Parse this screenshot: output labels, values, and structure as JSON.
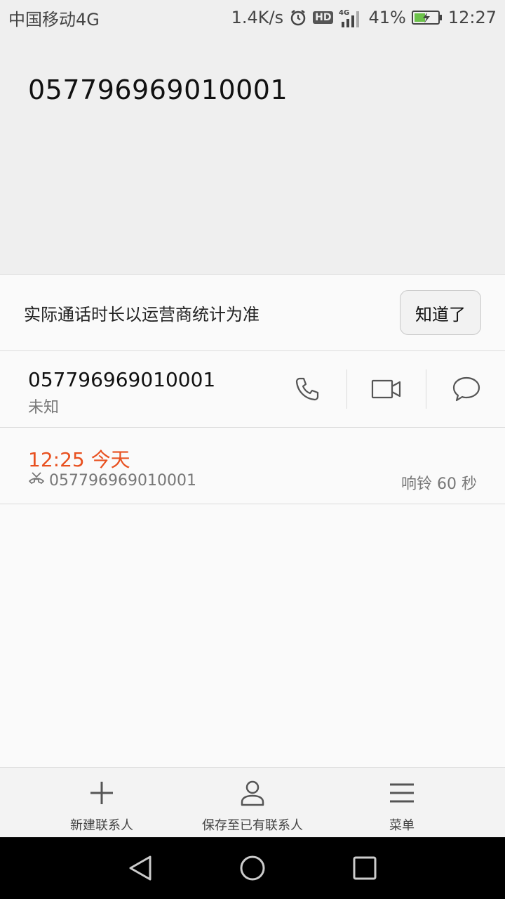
{
  "status_bar": {
    "carrier": "中国移动4G",
    "speed": "1.4K/s",
    "hd": "HD",
    "network": "4G",
    "battery": "41%",
    "time": "12:27"
  },
  "header": {
    "phone_number": "057796969010001"
  },
  "notice": {
    "text": "实际通话时长以运营商统计为准",
    "button_label": "知道了"
  },
  "contact": {
    "number": "057796969010001",
    "location": "未知",
    "actions": [
      "phone-icon",
      "video-call-icon",
      "message-icon"
    ]
  },
  "call_record": {
    "time": "12:25 今天",
    "number": "057796969010001",
    "duration": "响铃 60 秒",
    "accent_color": "#e8501f"
  },
  "toolbar": {
    "items": [
      {
        "label": "新建联系人",
        "icon": "plus-icon"
      },
      {
        "label": "保存至已有联系人",
        "icon": "person-icon"
      },
      {
        "label": "菜单",
        "icon": "menu-icon"
      }
    ]
  },
  "nav_bar": {
    "buttons": [
      "back-icon",
      "home-icon",
      "recents-icon"
    ]
  }
}
